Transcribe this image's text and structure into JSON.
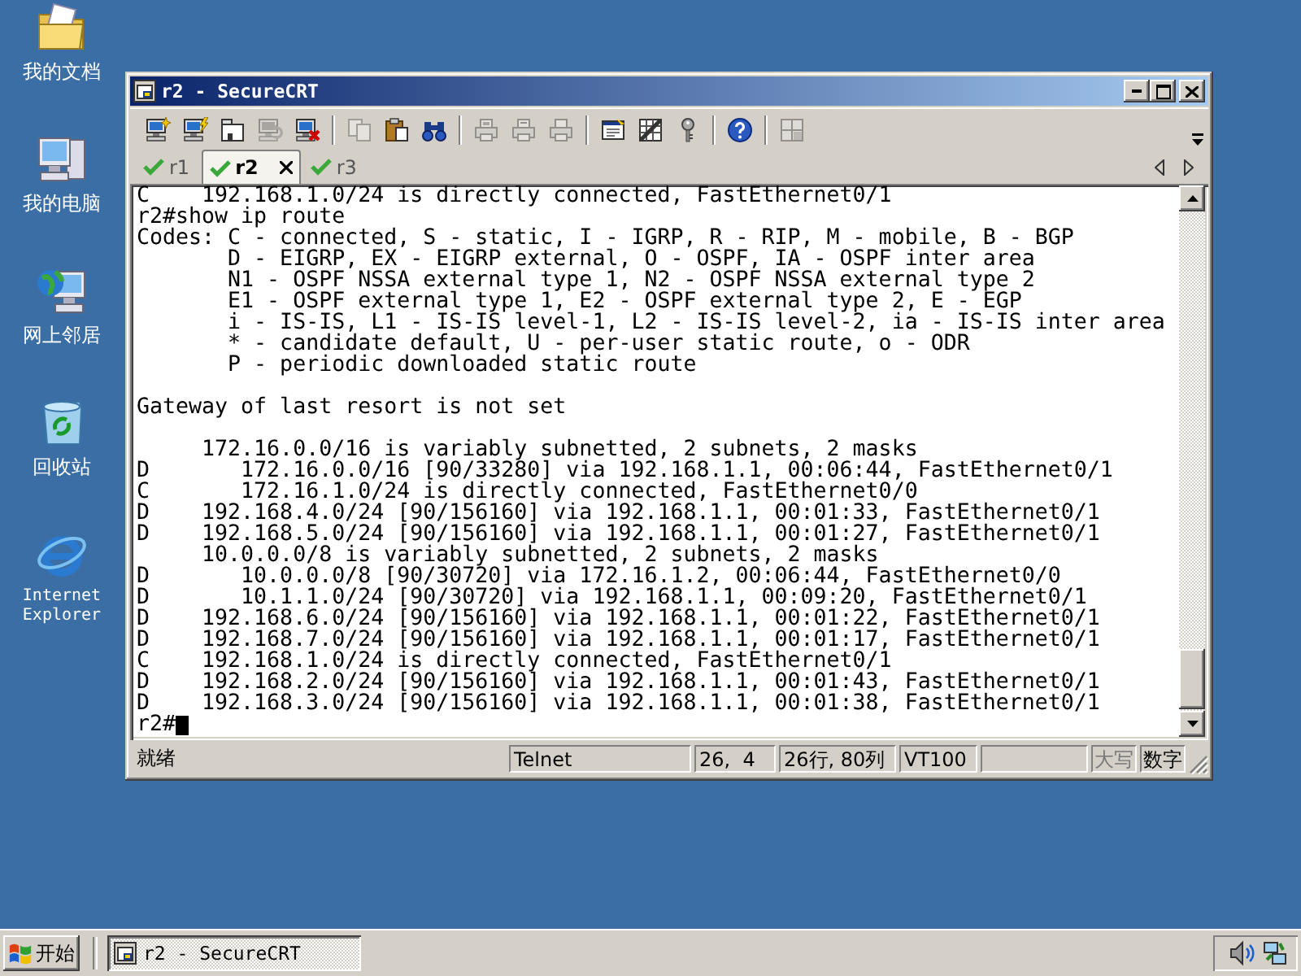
{
  "desktop": {
    "icons": [
      {
        "kind": "folder",
        "label": "我的文档"
      },
      {
        "kind": "computer",
        "label": "我的电脑"
      },
      {
        "kind": "network",
        "label": "网上邻居"
      },
      {
        "kind": "recycle-bin",
        "label": "回收站"
      },
      {
        "kind": "browser",
        "label": "Internet Explorer"
      }
    ]
  },
  "window": {
    "title": "r2 - SecureCRT",
    "toolbar": {
      "groups": [
        [
          {
            "kind": "new-connection",
            "disabled": false
          },
          {
            "kind": "quick-connect",
            "disabled": false
          },
          {
            "kind": "session-tab",
            "disabled": false
          },
          {
            "kind": "reconnect",
            "disabled": true
          },
          {
            "kind": "disconnect",
            "disabled": false
          }
        ],
        [
          {
            "kind": "copy",
            "disabled": true
          },
          {
            "kind": "paste",
            "disabled": false
          },
          {
            "kind": "find",
            "disabled": false
          }
        ],
        [
          {
            "kind": "print-screen",
            "disabled": true
          },
          {
            "kind": "print-selection",
            "disabled": true
          },
          {
            "kind": "print",
            "disabled": true
          }
        ],
        [
          {
            "kind": "properties",
            "disabled": false
          },
          {
            "kind": "keymap",
            "disabled": false
          },
          {
            "kind": "key",
            "disabled": false
          }
        ],
        [
          {
            "kind": "help",
            "disabled": false
          }
        ],
        [
          {
            "kind": "grid",
            "disabled": true
          }
        ]
      ]
    },
    "tabs": [
      {
        "label": "r1",
        "selected": false,
        "connected": true
      },
      {
        "label": "r2",
        "selected": true,
        "connected": true
      },
      {
        "label": "r3",
        "selected": false,
        "connected": true
      }
    ],
    "terminal": {
      "blocks": [
        [
          "C    192.168.1.0/24 is directly connected, FastEthernet0/1",
          "r2#show ip route",
          "Codes: C - connected, S - static, I - IGRP, R - RIP, M - mobile, B - BGP",
          "       D - EIGRP, EX - EIGRP external, O - OSPF, IA - OSPF inter area",
          "       N1 - OSPF NSSA external type 1, N2 - OSPF NSSA external type 2",
          "       E1 - OSPF external type 1, E2 - OSPF external type 2, E - EGP",
          "       i - IS-IS, L1 - IS-IS level-1, L2 - IS-IS level-2, ia - IS-IS inter area",
          "       * - candidate default, U - per-user static route, o - ODR",
          "       P - periodic downloaded static route"
        ],
        [
          "Gateway of last resort is not set"
        ],
        [
          "     172.16.0.0/16 is variably subnetted, 2 subnets, 2 masks",
          "D       172.16.0.0/16 [90/33280] via 192.168.1.1, 00:06:44, FastEthernet0/1",
          "C       172.16.1.0/24 is directly connected, FastEthernet0/0",
          "D    192.168.4.0/24 [90/156160] via 192.168.1.1, 00:01:33, FastEthernet0/1",
          "D    192.168.5.0/24 [90/156160] via 192.168.1.1, 00:01:27, FastEthernet0/1",
          "     10.0.0.0/8 is variably subnetted, 2 subnets, 2 masks",
          "D       10.0.0.0/8 [90/30720] via 172.16.1.2, 00:06:44, FastEthernet0/0",
          "D       10.1.1.0/24 [90/30720] via 192.168.1.1, 00:09:20, FastEthernet0/1",
          "D    192.168.6.0/24 [90/156160] via 192.168.1.1, 00:01:22, FastEthernet0/1",
          "D    192.168.7.0/24 [90/156160] via 192.168.1.1, 00:01:17, FastEthernet0/1",
          "C    192.168.1.0/24 is directly connected, FastEthernet0/1",
          "D    192.168.2.0/24 [90/156160] via 192.168.1.1, 00:01:43, FastEthernet0/1",
          "D    192.168.3.0/24 [90/156160] via 192.168.1.1, 00:01:38, FastEthernet0/1"
        ]
      ],
      "prompt": "r2#"
    },
    "status_bar": {
      "message": "就绪",
      "panes": [
        {
          "kind": "text",
          "text": "Telnet"
        },
        {
          "kind": "text",
          "text": "26,  4"
        },
        {
          "kind": "text",
          "text": "26行, 80列"
        },
        {
          "kind": "text",
          "text": "VT100"
        },
        {
          "kind": "blank"
        },
        {
          "kind": "indicator",
          "text": "大写",
          "on": false
        },
        {
          "kind": "indicator",
          "text": "数字",
          "on": true
        }
      ]
    }
  },
  "taskbar": {
    "start": "开始",
    "tasks": [
      {
        "label": "r2 - SecureCRT",
        "selected": true
      }
    ]
  }
}
